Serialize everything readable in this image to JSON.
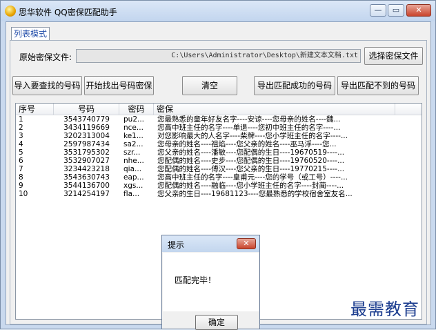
{
  "window": {
    "title": "思华软件  QQ密保匹配助手",
    "minimize": "—",
    "maximize": "▭",
    "close": "✕",
    "accent": "#c9d9ee"
  },
  "tab": {
    "label": "列表模式"
  },
  "file": {
    "label": "原始密保文件:",
    "path": "C:\\Users\\Administrator\\Desktop\\新建文本文档.txt",
    "choose_button": "选择密保文件"
  },
  "toolbar": {
    "import_button": "导入要查找的号码",
    "find_button": "开始找出号码密保",
    "clear_button": "清空",
    "export_ok_button": "导出匹配成功的号码",
    "export_fail_button": "导出匹配不到的号码"
  },
  "list": {
    "columns": [
      "序号",
      "号码",
      "密码",
      "密保"
    ],
    "rows": [
      {
        "idx": "1",
        "number": "3543740779",
        "pwd": "pu2...",
        "security": "您最熟悉的童年好友名字----安谅----您母亲的姓名----魏..."
      },
      {
        "idx": "2",
        "number": "3434119669",
        "pwd": "nce...",
        "security": "您高中班主任的名字----单退----您初中班主任的名字----..."
      },
      {
        "idx": "3",
        "number": "3202313004",
        "pwd": "ke1...",
        "security": "对您影响最大的人名字----柴牌----您小学班主任的名字----..."
      },
      {
        "idx": "4",
        "number": "2597987434",
        "pwd": "sa2...",
        "security": "您母亲的姓名----祖焰----您父亲的姓名----巫马浮----您..."
      },
      {
        "idx": "5",
        "number": "3531795302",
        "pwd": "szr...",
        "security": "您父亲的姓名----潘敏----您配偶的生日----19670519----..."
      },
      {
        "idx": "6",
        "number": "3532907027",
        "pwd": "nhe...",
        "security": "您配偶的姓名----史步----您配偶的生日----19760520----..."
      },
      {
        "idx": "7",
        "number": "3234423218",
        "pwd": "qia...",
        "security": "您配偶的姓名----傅汉----您父亲的生日----19770215----..."
      },
      {
        "idx": "8",
        "number": "3543630743",
        "pwd": "eap...",
        "security": "您高中班主任的名字----皇甫元----您的学号（或工号）----..."
      },
      {
        "idx": "9",
        "number": "3544136700",
        "pwd": "xgs...",
        "security": "您配偶的姓名----融临----您小学班主任的名字----封蔺----..."
      },
      {
        "idx": "10",
        "number": "3214254197",
        "pwd": "fla...",
        "security": "您父亲的生日----19681123----您最熟悉的学校宿舍室友名..."
      }
    ]
  },
  "dialog": {
    "title": "提示",
    "message": "匹配完毕！",
    "ok_button": "确定",
    "close": "✕"
  },
  "watermark": "最需教育"
}
